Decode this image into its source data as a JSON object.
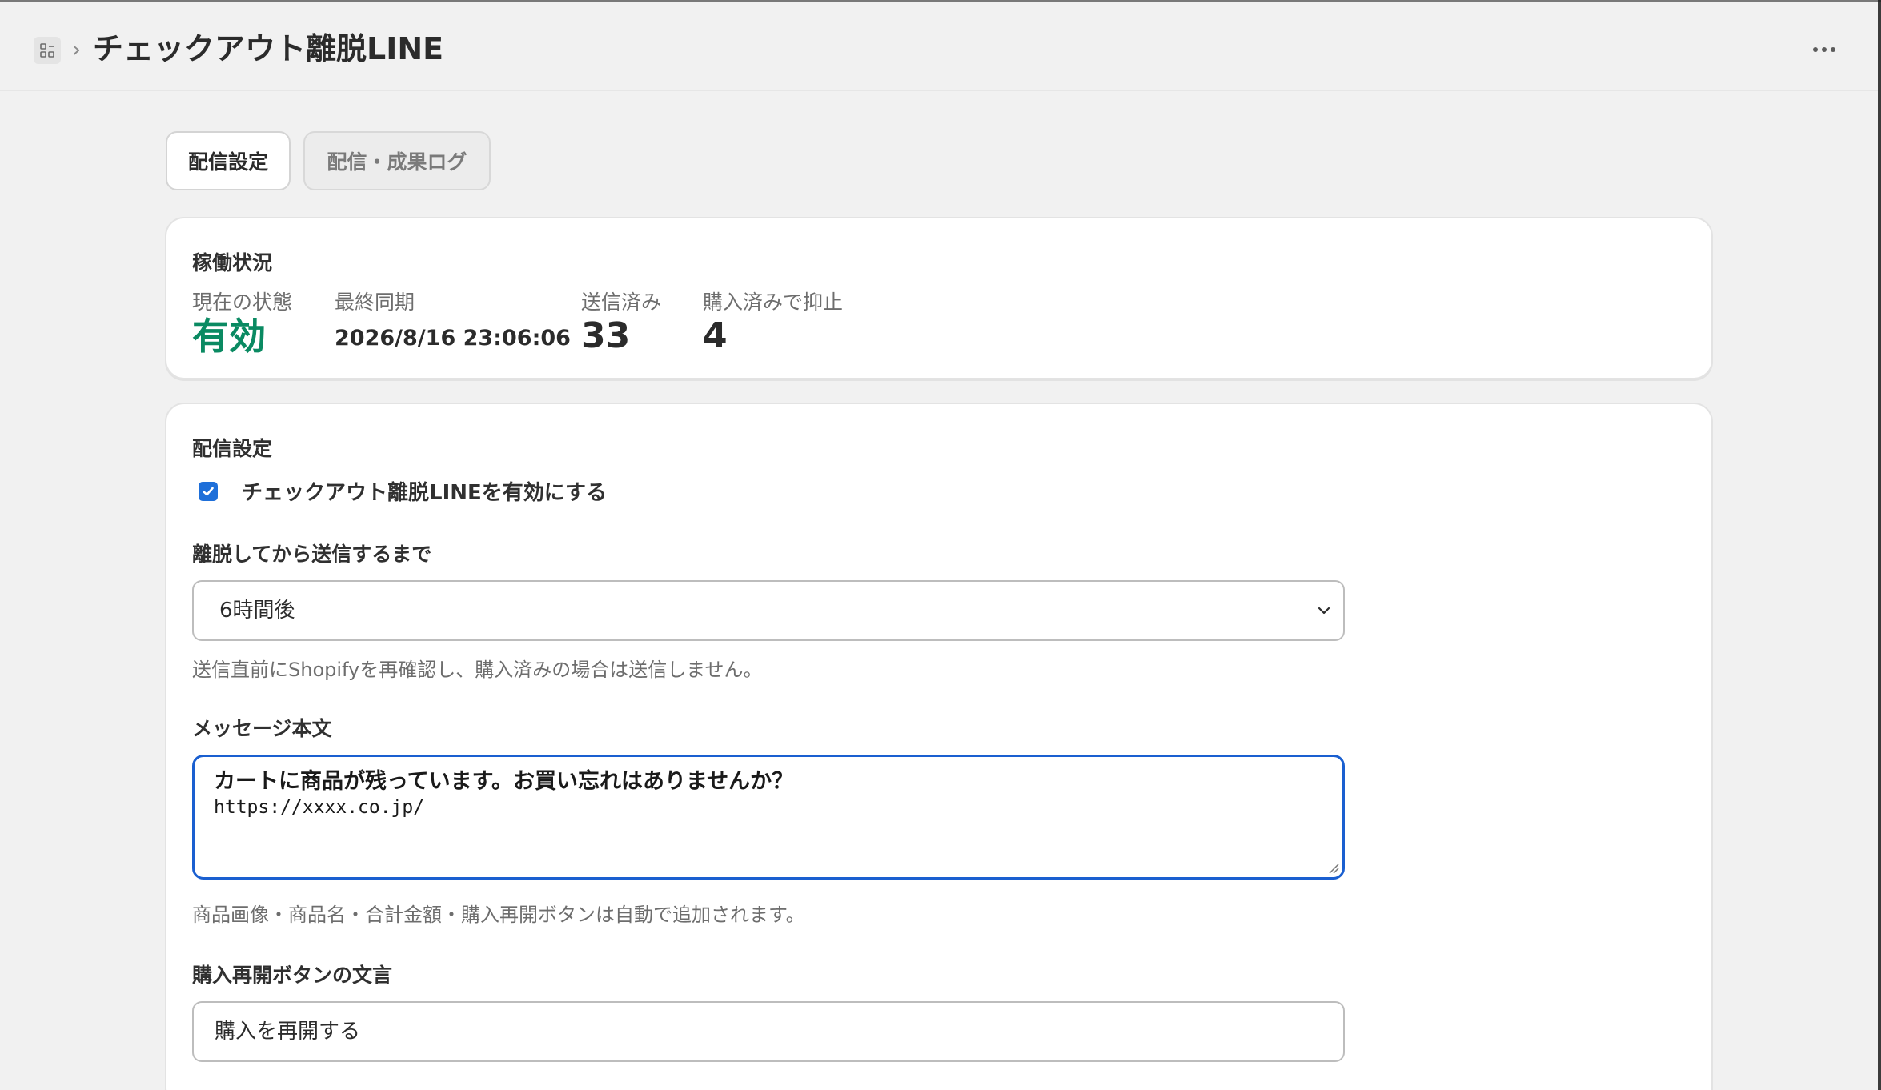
{
  "header": {
    "app_icon": "apps-icon",
    "breadcrumb_separator": "›",
    "title": "チェックアウト離脱LINE",
    "more_icon": "ellipsis-icon"
  },
  "tabs": [
    {
      "label": "配信設定",
      "active": true
    },
    {
      "label": "配信・成果ログ",
      "active": false
    }
  ],
  "status_card": {
    "title": "稼働状況",
    "stats": [
      {
        "label": "現在の状態",
        "value": "有効"
      },
      {
        "label": "最終同期",
        "value": "2026/8/16 23:06:06"
      },
      {
        "label": "送信済み",
        "value": "33"
      },
      {
        "label": "購入済みで抑止",
        "value": "4"
      }
    ],
    "colors": {
      "active": "#0a8a62"
    }
  },
  "settings_card": {
    "title": "配信設定",
    "enable_checkbox": {
      "label": "チェックアウト離脱LINEを有効にする",
      "checked": true
    },
    "delay": {
      "label": "離脱してから送信するまで",
      "selected": "6時間後",
      "help": "送信直前にShopifyを再確認し、購入済みの場合は送信しません。"
    },
    "message": {
      "label": "メッセージ本文",
      "line1": "カートに商品が残っています。お買い忘れはありませんか？",
      "line2": "https://xxxx.co.jp/",
      "help": "商品画像・商品名・合計金額・購入再開ボタンは自動で追加されます。"
    },
    "button_text": {
      "label": "購入再開ボタンの文言",
      "value": "購入を再開する"
    }
  },
  "colors": {
    "accent": "#1a5fd0",
    "background": "#f1f1f1"
  }
}
